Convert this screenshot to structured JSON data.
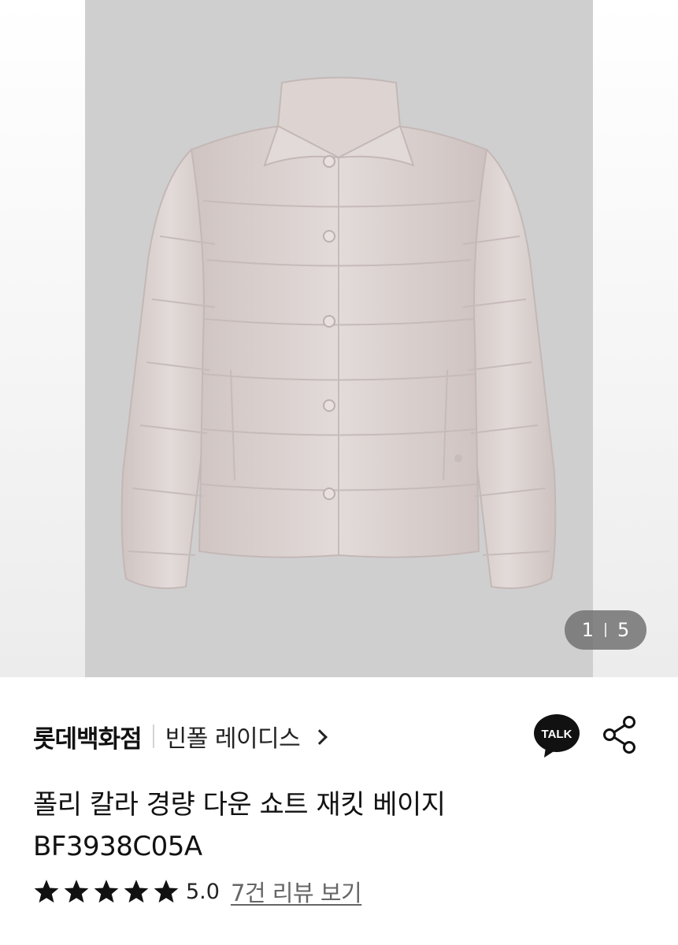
{
  "gallery": {
    "image_alt": "product-photo",
    "current": "1",
    "total": "5"
  },
  "brand": {
    "store": "롯데백화점",
    "brand_name": "빈폴 레이디스"
  },
  "actions": {
    "talk_label": "TALK"
  },
  "product": {
    "title_line1": "폴리 칼라 경량 다운 쇼트 재킷 베이지",
    "title_line2": "BF3938C05A"
  },
  "rating": {
    "stars": 5,
    "score": "5.0",
    "review_link": "7건 리뷰 보기"
  },
  "colors": {
    "photo_bg": "#cfcfd0",
    "jacket": "#dcd3d1",
    "counter_bg": "#6e6e6e"
  }
}
